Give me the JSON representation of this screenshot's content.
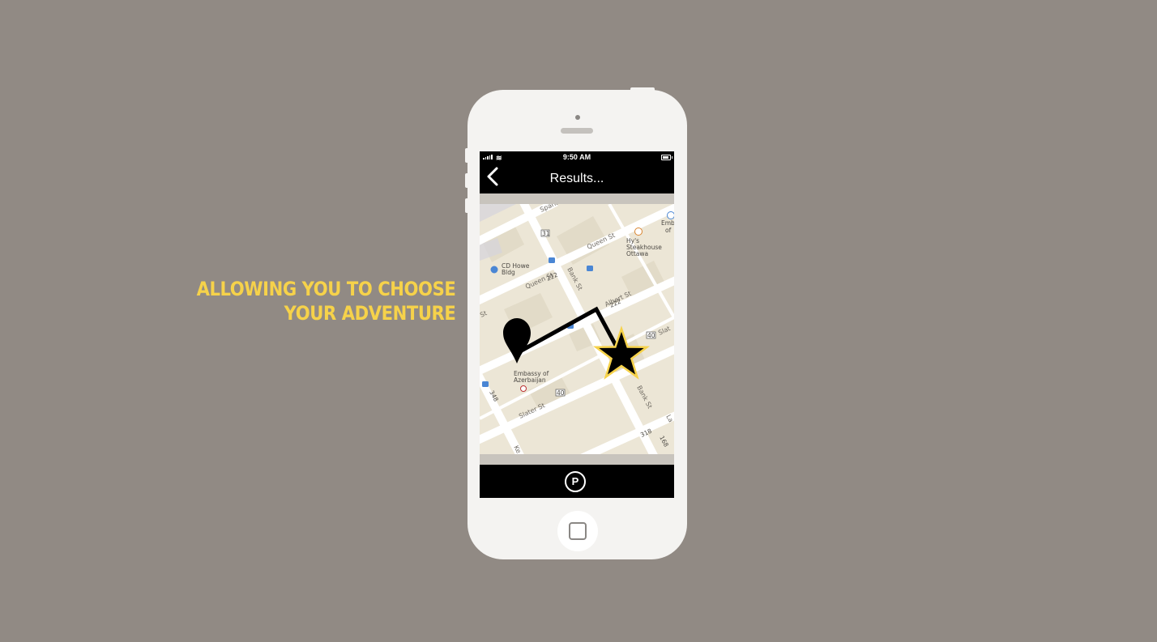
{
  "tagline": {
    "line1": "ALLOWING YOU TO CHOOSE",
    "line2": "YOUR ADVENTURE"
  },
  "status_bar": {
    "time": "9:50 AM",
    "signal_icon": "signal-bars-icon",
    "wifi_icon": "wifi-icon",
    "battery_icon": "battery-icon"
  },
  "nav": {
    "title": "Results...",
    "back_icon": "chevron-left-icon"
  },
  "map": {
    "streets": {
      "sparks": "Sparks",
      "queen_top": "Queen St",
      "queen_mid": "Queen St",
      "bank_top": "Bank St",
      "albert": "Albert St",
      "slater_right": "Slat",
      "slater_bottom": "Slater St",
      "bank_bottom": "Bank St",
      "st_left": "St",
      "kent": "Ke",
      "la": "La"
    },
    "route_numbers": {
      "r31": "31",
      "r222a": "222",
      "r222b": "222",
      "r40a": "40",
      "r40b": "40",
      "r348": "348",
      "r318": "318",
      "r168": "168"
    },
    "pois": {
      "cd_howe_1": "CD Howe",
      "cd_howe_2": "Bldg",
      "hys_1": "Hy's",
      "hys_2": "Steakhouse",
      "hys_3": "Ottawa",
      "embassy_right_1": "Emb",
      "embassy_right_2": "of",
      "azerbaijan_1": "Embassy of",
      "azerbaijan_2": "Azerbaijan"
    },
    "markers": {
      "start_icon": "map-pin-icon",
      "destination_icon": "star-icon",
      "route_color": "#000000",
      "star_outline_color": "#f6d24a"
    }
  },
  "tab_bar": {
    "parking_label": "P",
    "parking_icon": "parking-icon"
  },
  "colors": {
    "background": "#918a84",
    "accent": "#f6d24a",
    "phone_body": "#f4f3f1"
  }
}
